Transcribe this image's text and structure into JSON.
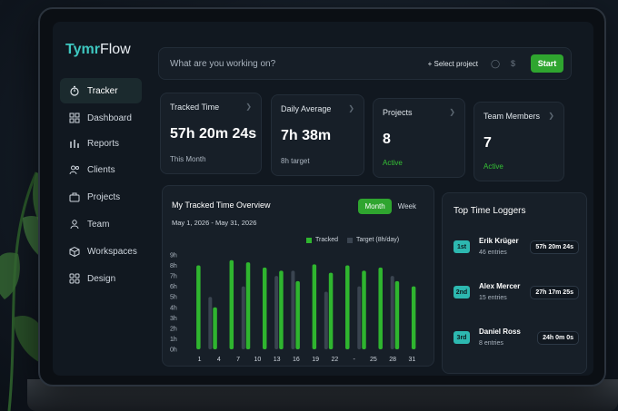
{
  "app": {
    "logo_a": "Tymr",
    "logo_b": "Flow"
  },
  "sidebar": {
    "items": [
      {
        "label": "Tracker",
        "active": true
      },
      {
        "label": "Dashboard"
      },
      {
        "label": "Reports"
      },
      {
        "label": "Clients"
      },
      {
        "label": "Projects"
      },
      {
        "label": "Team"
      },
      {
        "label": "Workspaces"
      },
      {
        "label": "Design"
      }
    ]
  },
  "topbar": {
    "placeholder": "What are you working on?",
    "select_project": "+ Select project",
    "start": "Start"
  },
  "stats": [
    {
      "label": "Tracked Time",
      "value": "57h 20m 24s",
      "sub": "This Month",
      "sub_color": "#aab4bf"
    },
    {
      "label": "Daily Average",
      "value": "7h 38m",
      "sub": "8h target",
      "sub_color": "#aab4bf"
    },
    {
      "label": "Projects",
      "value": "8",
      "sub": "Active",
      "sub_color": "#35c235"
    },
    {
      "label": "Team Members",
      "value": "7",
      "sub": "Active",
      "sub_color": "#35c235"
    }
  ],
  "overview": {
    "title": "My Tracked Time Overview",
    "range": "May 1, 2026 - May 31, 2026",
    "tab_month": "Month",
    "tab_week": "Week",
    "legend_tracked": "Tracked",
    "legend_target": "Target (8h/day)"
  },
  "chart_data": {
    "type": "bar",
    "y_ticks": [
      "0h",
      "1h",
      "2h",
      "3h",
      "4h",
      "5h",
      "6h",
      "7h",
      "8h",
      "9h"
    ],
    "x_ticks": [
      "1",
      "4",
      "7",
      "10",
      "13",
      "16",
      "19",
      "22",
      "-",
      "25",
      "28",
      "31"
    ],
    "ylim": [
      0,
      9
    ],
    "tracked": [
      8.0,
      4.0,
      8.5,
      8.3,
      7.8,
      7.5,
      6.5,
      8.1,
      7.3,
      8.0,
      7.5,
      7.8,
      6.5,
      6.0
    ],
    "target": [
      0,
      5.0,
      0,
      6.0,
      0,
      7.0,
      7.5,
      0,
      5.5,
      0,
      6.0,
      0,
      7.0,
      0
    ],
    "colors": {
      "tracked": "#2fb52f",
      "target": "#3a4450"
    }
  },
  "loggers": {
    "title": "Top Time Loggers",
    "rows": [
      {
        "rank": "1st",
        "name": "Erik Krüger",
        "entries": "46 entries",
        "time": "57h 20m 24s"
      },
      {
        "rank": "2nd",
        "name": "Alex Mercer",
        "entries": "15 entries",
        "time": "27h 17m 25s"
      },
      {
        "rank": "3rd",
        "name": "Daniel Ross",
        "entries": "8 entries",
        "time": "24h 0m 0s"
      }
    ]
  }
}
